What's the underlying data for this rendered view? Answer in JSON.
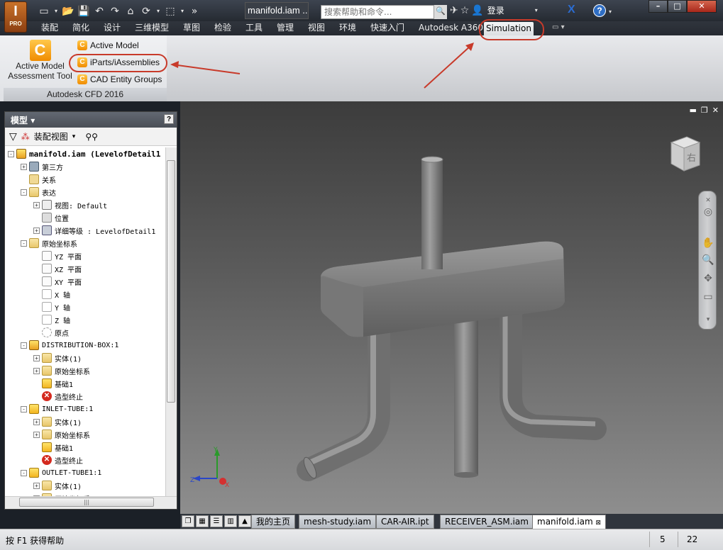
{
  "app": {
    "logo_letter": "I",
    "edition": "PRO",
    "document_title": "manifold.iam ...",
    "help_search_placeholder": "搜索帮助和命令...",
    "signin_label": "登录"
  },
  "ribbon_tabs": [
    "装配",
    "简化",
    "设计",
    "三维模型",
    "草图",
    "检验",
    "工具",
    "管理",
    "视图",
    "环境",
    "快速入门",
    "Autodesk A360",
    "Simulation"
  ],
  "active_tab": "Simulation",
  "ribbon_panel": {
    "title": "Autodesk CFD 2016",
    "big_button": {
      "line1": "Active Model",
      "line2": "Assessment Tool"
    },
    "small_buttons": [
      "Active Model",
      "iParts/iAssemblies",
      "CAD Entity Groups"
    ]
  },
  "browser": {
    "title": "模型",
    "view_label": "装配视图",
    "tree": [
      {
        "label": "manifold.iam (LevelofDetail1",
        "icon": "asm",
        "level": 0,
        "exp": "-",
        "root": true
      },
      {
        "label": "第三方",
        "icon": "third",
        "level": 1,
        "exp": "+"
      },
      {
        "label": "关系",
        "icon": "rel",
        "level": 1,
        "exp": ""
      },
      {
        "label": "表达",
        "icon": "folder",
        "level": 1,
        "exp": "-"
      },
      {
        "label": "视图: Default",
        "icon": "view",
        "level": 2,
        "exp": "+"
      },
      {
        "label": "位置",
        "icon": "pos",
        "level": 2,
        "exp": ""
      },
      {
        "label": "详细等级 : LevelofDetail1",
        "icon": "lod",
        "level": 2,
        "exp": "+"
      },
      {
        "label": "原始坐标系",
        "icon": "folder",
        "level": 1,
        "exp": "-"
      },
      {
        "label": "YZ 平面",
        "icon": "plane",
        "level": 2,
        "exp": ""
      },
      {
        "label": "XZ 平面",
        "icon": "plane",
        "level": 2,
        "exp": ""
      },
      {
        "label": "XY 平面",
        "icon": "plane",
        "level": 2,
        "exp": ""
      },
      {
        "label": "X 轴",
        "icon": "axis",
        "level": 2,
        "exp": ""
      },
      {
        "label": "Y 轴",
        "icon": "axis",
        "level": 2,
        "exp": ""
      },
      {
        "label": "Z 轴",
        "icon": "axis",
        "level": 2,
        "exp": ""
      },
      {
        "label": "原点",
        "icon": "origin",
        "level": 2,
        "exp": ""
      },
      {
        "label": "DISTRIBUTION-BOX:1",
        "icon": "asm",
        "level": 1,
        "exp": "-"
      },
      {
        "label": "实体(1)",
        "icon": "folder",
        "level": 2,
        "exp": "+"
      },
      {
        "label": "原始坐标系",
        "icon": "folder",
        "level": 2,
        "exp": "+"
      },
      {
        "label": "基础1",
        "icon": "part",
        "level": 2,
        "exp": ""
      },
      {
        "label": "造型终止",
        "icon": "err",
        "level": 2,
        "exp": ""
      },
      {
        "label": "INLET-TUBE:1",
        "icon": "part",
        "level": 1,
        "exp": "-"
      },
      {
        "label": "实体(1)",
        "icon": "folder",
        "level": 2,
        "exp": "+"
      },
      {
        "label": "原始坐标系",
        "icon": "folder",
        "level": 2,
        "exp": "+"
      },
      {
        "label": "基础1",
        "icon": "part",
        "level": 2,
        "exp": ""
      },
      {
        "label": "造型终止",
        "icon": "err",
        "level": 2,
        "exp": ""
      },
      {
        "label": "OUTLET-TUBE1:1",
        "icon": "part",
        "level": 1,
        "exp": "-"
      },
      {
        "label": "实体(1)",
        "icon": "folder",
        "level": 2,
        "exp": "+"
      },
      {
        "label": "原始坐标系",
        "icon": "folder",
        "level": 2,
        "exp": "+"
      }
    ]
  },
  "viewcube_face": "右",
  "axis_labels": {
    "y": "Y",
    "z": "Z",
    "x": "X"
  },
  "doc_tabs": [
    "我的主页",
    "mesh-study.iam",
    "CAR-AIR.ipt",
    "RECEIVER_ASM.iam",
    "manifold.iam"
  ],
  "active_doc": "manifold.iam",
  "status": {
    "message": "按 F1 获得帮助",
    "count1": "5",
    "count2": "22"
  },
  "colors": {
    "annotation": "#c83a2a",
    "accent": "#f08c00"
  }
}
